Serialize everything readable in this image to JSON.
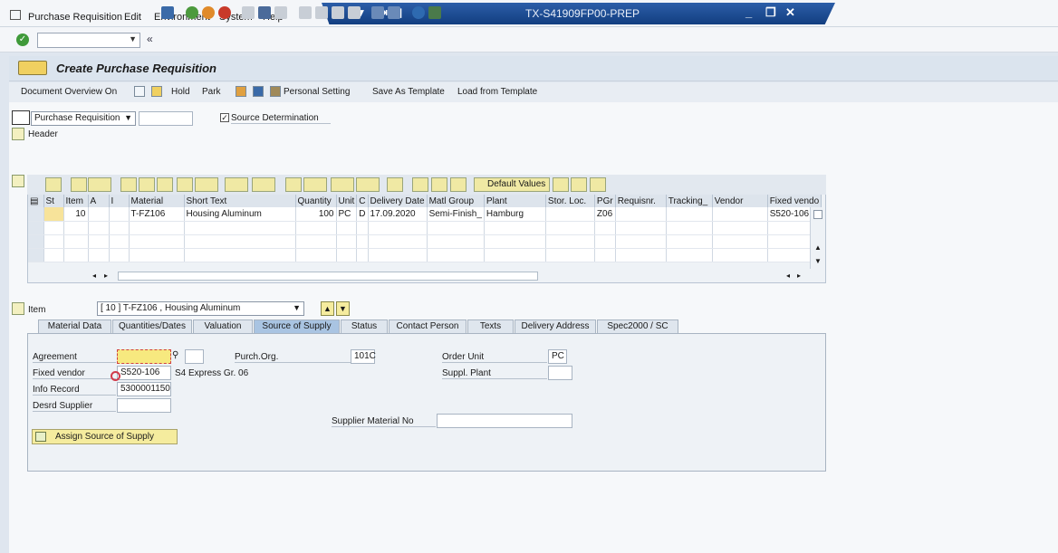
{
  "menubar": {
    "items": [
      "Purchase Requisition",
      "Edit",
      "Environment",
      "System",
      "Help"
    ]
  },
  "window": {
    "system_name": "TX-S41909FP00-PREP"
  },
  "page": {
    "title": "Create Purchase Requisition"
  },
  "app_toolbar": {
    "document_overview": "Document Overview On",
    "hold": "Hold",
    "park": "Park",
    "personal_setting": "Personal Setting",
    "save_as_template": "Save As Template",
    "load_from_template": "Load from Template"
  },
  "header_area": {
    "doc_type": "Purchase Requisition",
    "source_determination": "Source Determination",
    "header_label": "Header"
  },
  "grid": {
    "default_values": "Default Values",
    "columns": [
      "St",
      "Item",
      "A",
      "I",
      "Material",
      "Short Text",
      "Quantity",
      "Unit",
      "C",
      "Delivery Date",
      "Matl Group",
      "Plant",
      "Stor. Loc.",
      "PGr",
      "Requisnr.",
      "Tracking_",
      "Vendor",
      "Fixed vendo"
    ],
    "rows": [
      [
        "",
        "10",
        "",
        "",
        "T-FZ106",
        "Housing Aluminum",
        "100",
        "PC",
        "D",
        "17.09.2020",
        "Semi-Finish_",
        "Hamburg",
        "",
        "Z06",
        "",
        "",
        "",
        "S520-106"
      ]
    ]
  },
  "item_section": {
    "label": "Item",
    "selected_item": "[ 10 ] T-FZ106 , Housing Aluminum"
  },
  "tabs": [
    "Material Data",
    "Quantities/Dates",
    "Valuation",
    "Source of Supply",
    "Status",
    "Contact Person",
    "Texts",
    "Delivery Address",
    "Spec2000 / SC"
  ],
  "active_tab": "Source of Supply",
  "source_of_supply": {
    "agreement_label": "Agreement",
    "agreement_value": "",
    "fixed_vendor_label": "Fixed vendor",
    "fixed_vendor_value": "S520-106",
    "fixed_vendor_name": "S4 Express Gr. 06",
    "info_record_label": "Info Record",
    "info_record_value": "5300001150",
    "desired_supplier_label": "Desrd Supplier",
    "desired_supplier_value": "",
    "purch_org_label": "Purch.Org.",
    "purch_org_value": "101C",
    "order_unit_label": "Order Unit",
    "order_unit_value": "PC",
    "suppl_plant_label": "Suppl. Plant",
    "suppl_plant_value": "",
    "supplier_material_no_label": "Supplier Material No",
    "supplier_material_no_value": "",
    "assign_button": "Assign Source of Supply"
  },
  "colors": {
    "title_bar": "#1f4f95",
    "active_tab": "#a9c4e2",
    "highlight_field": "#f7e97f",
    "background": "#dfe6ef"
  }
}
